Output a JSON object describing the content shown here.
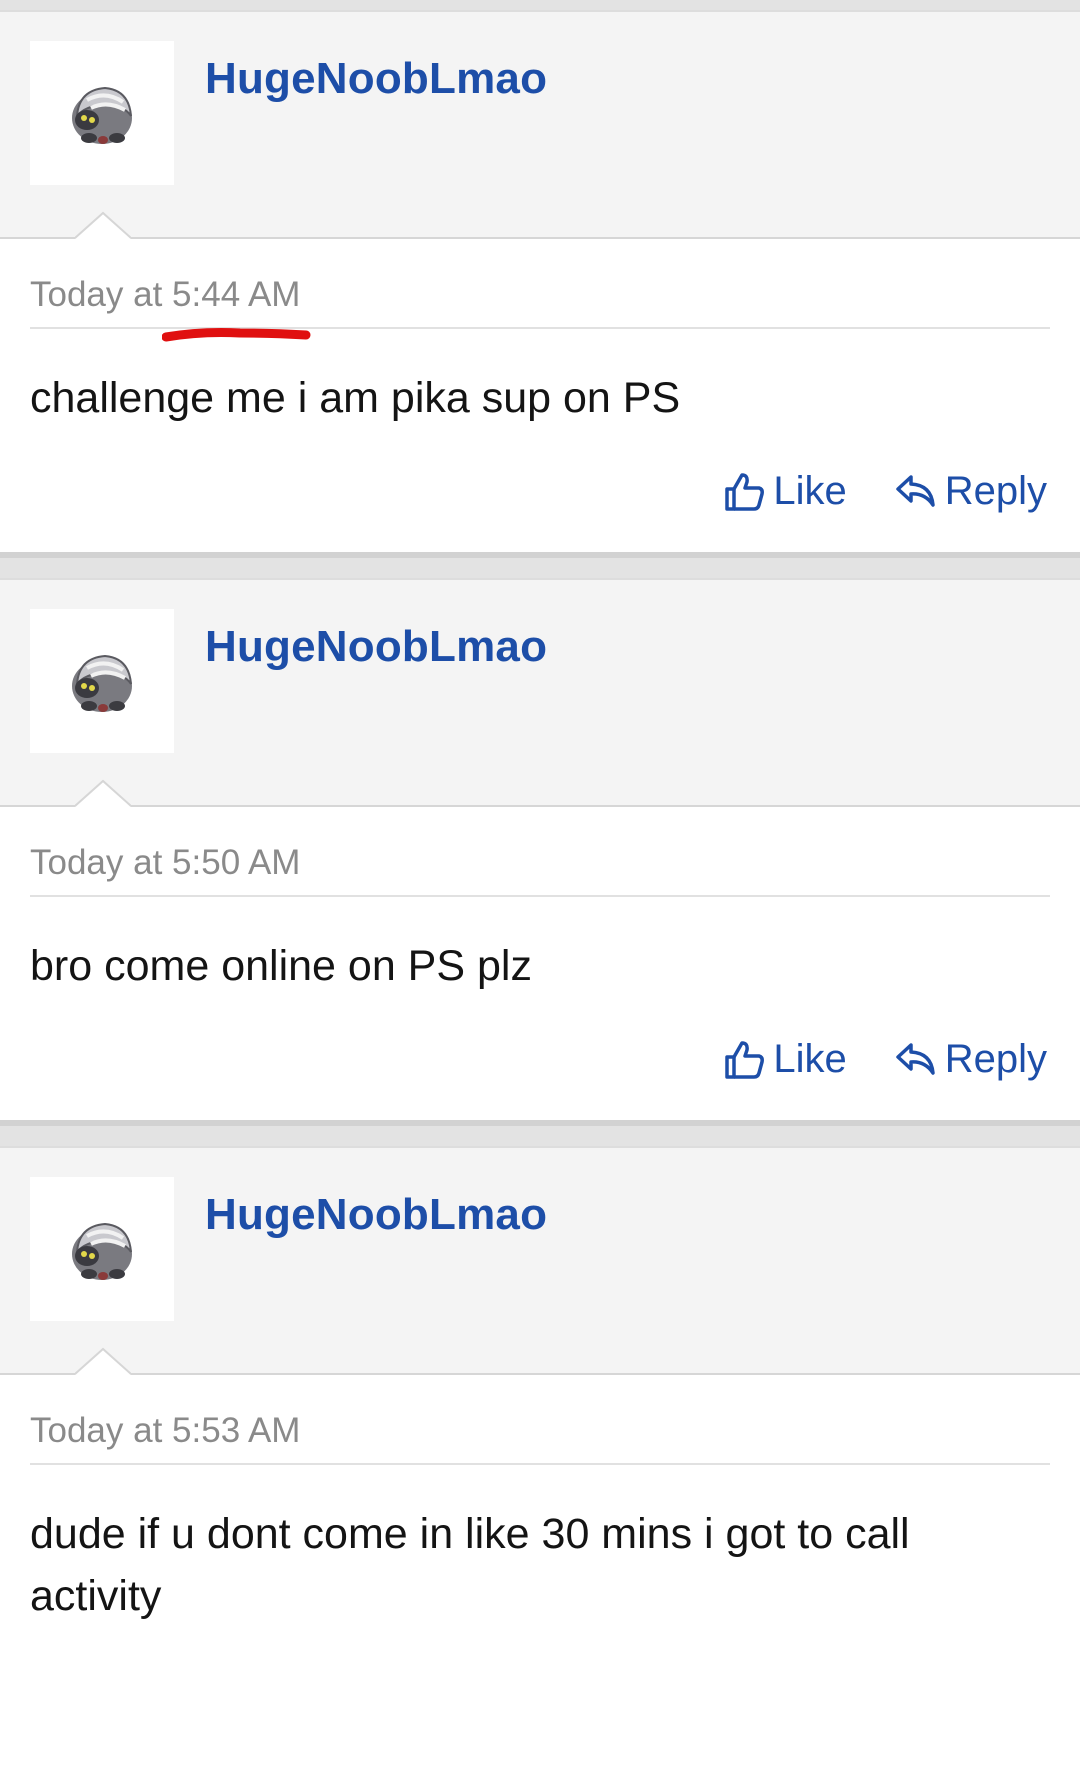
{
  "posts": [
    {
      "username": "HugeNoobLmao",
      "timestamp": "Today at 5:44 AM",
      "message": "challenge me i am pika sup on PS",
      "like_label": "Like",
      "reply_label": "Reply"
    },
    {
      "username": "HugeNoobLmao",
      "timestamp": "Today at 5:50 AM",
      "message": "bro come online on PS plz",
      "like_label": "Like",
      "reply_label": "Reply"
    },
    {
      "username": "HugeNoobLmao",
      "timestamp": "Today at 5:53 AM",
      "message": "dude if u dont come in like 30 mins i got to call activity"
    }
  ],
  "icons": {
    "avatar": "shelgon-avatar-icon",
    "like": "thumbs-up-icon",
    "reply": "reply-arrow-icon"
  },
  "colors": {
    "accent": "#1d4ea8",
    "annotation": "#e01010"
  }
}
